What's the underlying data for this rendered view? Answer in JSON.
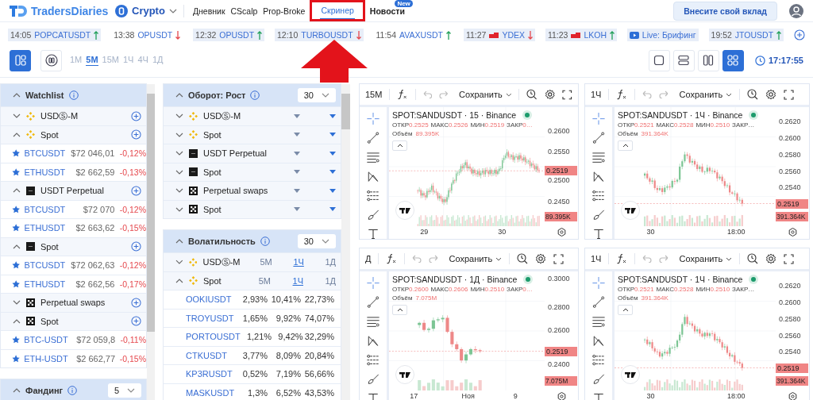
{
  "header": {
    "logo": "TradersDiaries",
    "market": "Crypto",
    "nav": [
      {
        "label": "Дневник",
        "selected": false,
        "highlighted": false
      },
      {
        "label": "CScalp",
        "selected": false,
        "highlighted": false
      },
      {
        "label": "Prop-Broke",
        "selected": false,
        "highlighted": false
      },
      {
        "label": "Скринер",
        "selected": true,
        "highlighted": true
      },
      {
        "label": "Новости",
        "selected": false,
        "highlighted": false,
        "badge": "New"
      }
    ],
    "contribute_button": "Внесите свой вклад"
  },
  "ticker": [
    {
      "kind": "crypto",
      "time": "14:05",
      "symbol": "POPCATUSDT",
      "rising": true,
      "highlighted": true
    },
    {
      "kind": "crypto",
      "time": "13:38",
      "symbol": "OPUSDT",
      "rising": false,
      "highlighted": false
    },
    {
      "kind": "crypto",
      "time": "12:32",
      "symbol": "OPUSDT",
      "rising": true,
      "highlighted": true
    },
    {
      "kind": "crypto",
      "time": "12:10",
      "symbol": "TURBOUSDT",
      "rising": false,
      "highlighted": true
    },
    {
      "kind": "crypto",
      "time": "11:54",
      "symbol": "AVAXUSDT",
      "rising": true,
      "highlighted": false
    },
    {
      "kind": "stock",
      "time": "11:27",
      "symbol": "YDEX",
      "rising": false,
      "highlighted": true
    },
    {
      "kind": "stock",
      "time": "11:23",
      "symbol": "LKOH",
      "rising": true,
      "highlighted": true
    },
    {
      "kind": "live",
      "symbol": "Live: Брифинг",
      "highlighted": true
    },
    {
      "kind": "crypto",
      "time": "19:52",
      "symbol": "JTOUSDT",
      "rising": true,
      "highlighted": true
    }
  ],
  "toolbar": {
    "view_modes": [
      {
        "kind": "panels",
        "selected": true
      },
      {
        "kind": "circle",
        "selected": false
      }
    ],
    "timeframes": [
      {
        "label": "1M",
        "selected": false
      },
      {
        "label": "5M",
        "selected": true
      },
      {
        "label": "15M",
        "selected": false
      },
      {
        "label": "1Ч",
        "selected": false
      },
      {
        "label": "4Ч",
        "selected": false
      },
      {
        "label": "1Д",
        "selected": false
      }
    ],
    "layouts": [
      {
        "kind": "single",
        "selected": false
      },
      {
        "kind": "rows",
        "selected": false
      },
      {
        "kind": "columns",
        "selected": false
      },
      {
        "kind": "grid",
        "selected": true
      }
    ],
    "clock": "17:17:55"
  },
  "watchlist": {
    "title": "Watchlist",
    "groups": [
      {
        "kind": "diamond",
        "name": "USDⓈ-M",
        "expanded": false
      },
      {
        "kind": "diamond",
        "name": "Spot",
        "expanded": true,
        "items": [
          {
            "symbol": "BTCUSDT",
            "price": "$72 046,01",
            "change": "-0,12%"
          },
          {
            "symbol": "ETHUSDT",
            "price": "$2 662,59",
            "change": "-0,13%"
          }
        ]
      },
      {
        "kind": "square",
        "name": "USDT Perpetual",
        "expanded": true,
        "items": [
          {
            "symbol": "BTCUSDT",
            "price": "$72 070",
            "change": "-0,12%"
          },
          {
            "symbol": "ETHUSDT",
            "price": "$2 663,62",
            "change": "-0,15%"
          }
        ]
      },
      {
        "kind": "square",
        "name": "Spot",
        "expanded": true,
        "items": [
          {
            "symbol": "BTCUSDT",
            "price": "$72 062,63",
            "change": "-0,12%"
          },
          {
            "symbol": "ETHUSDT",
            "price": "$2 662,56",
            "change": "-0,17%"
          }
        ]
      },
      {
        "kind": "cross",
        "name": "Perpetual swaps",
        "expanded": false
      },
      {
        "kind": "cross",
        "name": "Spot",
        "expanded": true,
        "items": [
          {
            "symbol": "BTC-USDT",
            "price": "$72 059,8",
            "change": "-0,11%"
          },
          {
            "symbol": "ETH-USDT",
            "price": "$2 662,77",
            "change": "-0,15%"
          }
        ]
      }
    ]
  },
  "turnover": {
    "title": "Оборот: Рост",
    "count": "30",
    "groups": [
      {
        "kind": "diamond",
        "name": "USDⓈ-M",
        "expanded": false
      },
      {
        "kind": "diamond",
        "name": "Spot",
        "expanded": false
      },
      {
        "kind": "square",
        "name": "USDT Perpetual",
        "expanded": false
      },
      {
        "kind": "square",
        "name": "Spot",
        "expanded": false
      },
      {
        "kind": "cross",
        "name": "Perpetual swaps",
        "expanded": false
      },
      {
        "kind": "cross",
        "name": "Spot",
        "expanded": false
      }
    ]
  },
  "volatility": {
    "title": "Волатильность",
    "count": "30",
    "groups": [
      {
        "kind": "diamond",
        "name": "USDⓈ-M",
        "expanded": false,
        "periods": [
          {
            "label": "5M",
            "selected": false
          },
          {
            "label": "1Ч",
            "selected": true
          },
          {
            "label": "1Д",
            "selected": false
          }
        ]
      },
      {
        "kind": "diamond",
        "name": "Spot",
        "expanded": true,
        "periods": [
          {
            "label": "5M",
            "selected": false
          },
          {
            "label": "1Ч",
            "selected": true
          },
          {
            "label": "1Д",
            "selected": false
          }
        ]
      }
    ],
    "rows": [
      {
        "symbol": "OOKIUSDT",
        "values": [
          "2,93%",
          "10,41%",
          "22,73%"
        ]
      },
      {
        "symbol": "TROYUSDT",
        "values": [
          "1,65%",
          "9,92%",
          "74,07%"
        ]
      },
      {
        "symbol": "PORTOUSDT",
        "values": [
          "1,21%",
          "9,42%",
          "32,29%"
        ]
      },
      {
        "symbol": "CTKUSDT",
        "values": [
          "3,77%",
          "8,09%",
          "20,84%"
        ]
      },
      {
        "symbol": "KP3RUSDT",
        "values": [
          "0,52%",
          "7,19%",
          "56,66%"
        ]
      },
      {
        "symbol": "MASKUSDT",
        "values": [
          "1,3%",
          "6,52%",
          "43,53%"
        ]
      }
    ]
  },
  "funding": {
    "title": "Фандинг",
    "count": "5"
  },
  "charts": [
    {
      "interval": "15M",
      "save_label": "Сохранить",
      "title": "SPOT:SANDUSDT · 15 · Binance",
      "ohlc": [
        {
          "label": "ОТКР",
          "value": "0.2525"
        },
        {
          "label": "МАКС",
          "value": "0.2526"
        },
        {
          "label": "МИН",
          "value": "0.2519"
        },
        {
          "label": "ЗАКР",
          "value": "0…"
        }
      ],
      "volume_label": "Объём",
      "volume": "89.395K",
      "yticks": [
        "0.2600",
        "0.2550",
        "0.2500",
        "0.2450"
      ],
      "xticks": [
        "29",
        "30"
      ],
      "price": "0.2519",
      "volume_pill": "89.395K"
    },
    {
      "interval": "1Ч",
      "save_label": "Сохранить",
      "title": "SPOT:SANDUSDT · 1Ч · Binance",
      "ohlc": [
        {
          "label": "ОТКР",
          "value": "0.2521"
        },
        {
          "label": "МАКС",
          "value": "0.2528"
        },
        {
          "label": "МИН",
          "value": "0.2510"
        },
        {
          "label": "ЗАКР…"
        }
      ],
      "volume_label": "Объём",
      "volume": "391.364K",
      "yticks": [
        "0.2620",
        "0.2600",
        "0.2580",
        "0.2560",
        "0.2540"
      ],
      "xticks": [
        "30",
        "18:00"
      ],
      "price": "0.2519",
      "volume_pill": "391.364K"
    },
    {
      "interval": "Д",
      "save_label": "Сохранить",
      "title": "SPOT:SANDUSDT · 1Д · Binance",
      "ohlc": [
        {
          "label": "ОТКР",
          "value": "0.2600"
        },
        {
          "label": "МАКС",
          "value": "0.2606"
        },
        {
          "label": "МИН",
          "value": "0.2510"
        },
        {
          "label": "ЗАКР",
          "value": "0…"
        }
      ],
      "volume_label": "Объём",
      "volume": "7.075M",
      "yticks": [
        "0.3000",
        "0.2800",
        "0.2600",
        "0.2400"
      ],
      "xticks": [
        "17",
        "Ноя",
        "9"
      ],
      "price": "0.2519",
      "volume_pill": "7.075M"
    },
    {
      "interval": "1Ч",
      "save_label": "Сохранить",
      "title": "SPOT:SANDUSDT · 1Ч · Binance",
      "ohlc": [
        {
          "label": "ОТКР",
          "value": "0.2521"
        },
        {
          "label": "МАКС",
          "value": "0.2528"
        },
        {
          "label": "МИН",
          "value": "0.2510"
        },
        {
          "label": "ЗАКР…"
        }
      ],
      "volume_label": "Объём",
      "volume": "391.364K",
      "yticks": [
        "0.2620",
        "0.2600",
        "0.2580",
        "0.2560",
        "0.2540"
      ],
      "xticks": [
        "30",
        "18:00"
      ],
      "price": "0.2519",
      "volume_pill": "391.364K"
    }
  ]
}
